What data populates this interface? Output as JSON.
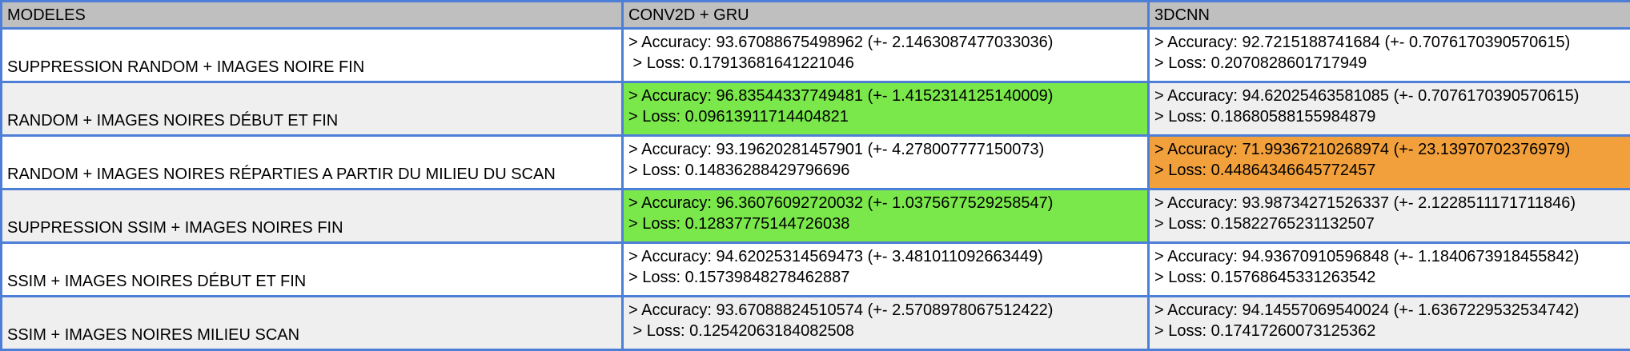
{
  "table": {
    "headers": [
      "MODELES",
      "CONV2D + GRU",
      "3DCNN"
    ],
    "highlight_colors": {
      "green": "#7ae84a",
      "orange": "#f2a03c",
      "header": "#bfbfbf",
      "grid": "#4d7fd6"
    },
    "rows": [
      {
        "model": "SUPPRESSION RANDOM + IMAGES NOIRE FIN",
        "conv": {
          "accuracy": "> Accuracy: 93.67088675498962 (+- 2.1463087477033036)",
          "loss": " > Loss: 0.17913681641221046",
          "highlight": ""
        },
        "cnn": {
          "accuracy": "> Accuracy: 92.7215188741684 (+- 0.7076170390570615)",
          "loss": "> Loss: 0.2070828601717949",
          "highlight": ""
        }
      },
      {
        "model": "RANDOM + IMAGES NOIRES DÉBUT ET FIN",
        "conv": {
          "accuracy": "> Accuracy: 96.83544337749481 (+- 1.4152314125140009)",
          "loss": "> Loss: 0.09613911714404821",
          "highlight": "green"
        },
        "cnn": {
          "accuracy": "> Accuracy: 94.62025463581085 (+- 0.7076170390570615)",
          "loss": "> Loss: 0.18680588155984879",
          "highlight": ""
        }
      },
      {
        "model": "RANDOM + IMAGES NOIRES RÉPARTIES A PARTIR DU MILIEU DU SCAN",
        "conv": {
          "accuracy": "> Accuracy: 93.19620281457901 (+- 4.278007777150073)",
          "loss": "> Loss: 0.14836288429796696",
          "highlight": ""
        },
        "cnn": {
          "accuracy": "> Accuracy: 71.99367210268974 (+- 23.13970702376979)",
          "loss": "> Loss: 0.44864346645772457",
          "highlight": "orange"
        }
      },
      {
        "model": "SUPPRESSION SSIM + IMAGES NOIRES FIN",
        "conv": {
          "accuracy": "> Accuracy: 96.36076092720032 (+- 1.0375677529258547)",
          "loss": "> Loss: 0.12837775144726038",
          "highlight": "green"
        },
        "cnn": {
          "accuracy": "> Accuracy: 93.98734271526337 (+- 2.1228511171711846)",
          "loss": "> Loss: 0.15822765231132507",
          "highlight": ""
        }
      },
      {
        "model": "SSIM + IMAGES NOIRES DÉBUT ET FIN",
        "conv": {
          "accuracy": "> Accuracy: 94.62025314569473 (+- 3.481011092663449)",
          "loss": "> Loss: 0.15739848278462887",
          "highlight": ""
        },
        "cnn": {
          "accuracy": "> Accuracy: 94.93670910596848 (+- 1.1840673918455842)",
          "loss": "> Loss: 0.15768645331263542",
          "highlight": ""
        }
      },
      {
        "model": "SSIM + IMAGES NOIRES MILIEU SCAN",
        "conv": {
          "accuracy": "> Accuracy: 93.67088824510574 (+- 2.5708978067512422)",
          "loss": " > Loss: 0.12542063184082508",
          "highlight": ""
        },
        "cnn": {
          "accuracy": "> Accuracy: 94.14557069540024 (+- 1.6367229532534742)",
          "loss": "> Loss: 0.17417260073125362",
          "highlight": ""
        }
      }
    ]
  }
}
